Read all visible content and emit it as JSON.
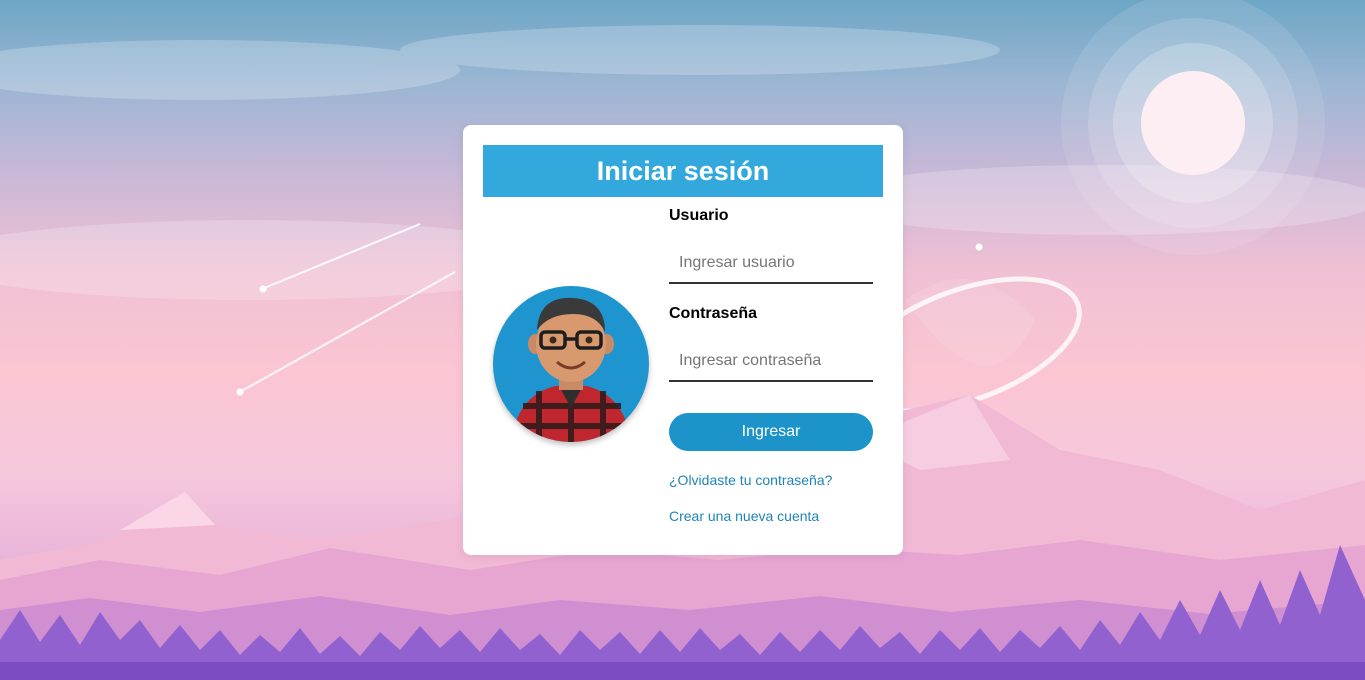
{
  "login": {
    "title": "Iniciar sesión",
    "username_label": "Usuario",
    "username_placeholder": "Ingresar usuario",
    "username_value": "",
    "password_label": "Contraseña",
    "password_placeholder": "Ingresar contraseña",
    "password_value": "",
    "submit_label": "Ingresar",
    "forgot_link": "¿Olvidaste tu contraseña?",
    "create_link": "Crear una nueva cuenta"
  },
  "avatar": {
    "icon": "user-avatar-icon"
  },
  "colors": {
    "header_bg": "#33a8dd",
    "button_bg": "#1c93c9",
    "link": "#1f84b7",
    "avatar_bg": "#1f95d0"
  }
}
